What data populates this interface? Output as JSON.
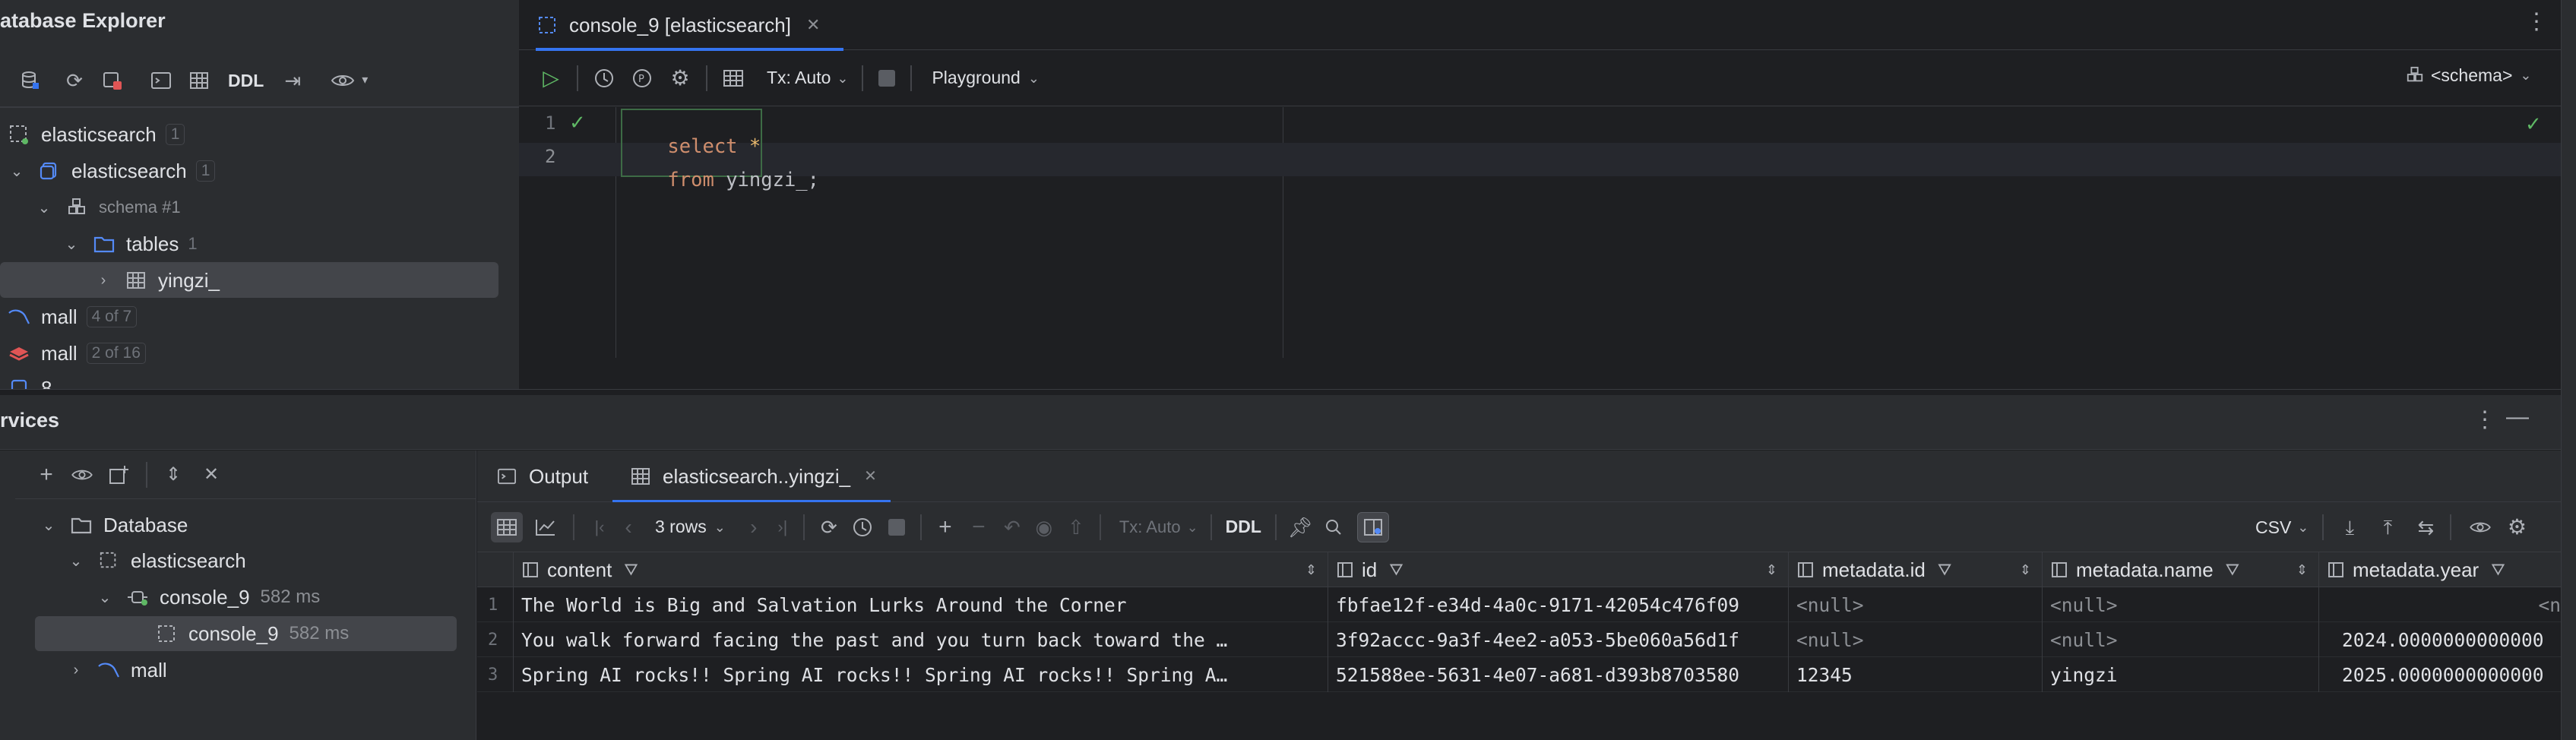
{
  "db_explorer": {
    "title": "atabase Explorer",
    "toolbar": {
      "ddl_label": "DDL"
    },
    "tree": [
      {
        "label": "elasticsearch",
        "count": "1"
      },
      {
        "label": "elasticsearch",
        "count": "1"
      },
      {
        "label": "schema #1",
        "count": ""
      },
      {
        "label": "tables",
        "count": "1"
      },
      {
        "label": "yingzi_",
        "count": ""
      },
      {
        "label": "mall",
        "count": "4 of 7"
      },
      {
        "label": "mall",
        "count": "2 of 16"
      },
      {
        "label": "8",
        "count": ""
      }
    ]
  },
  "editor": {
    "tab_label": "console_9 [elasticsearch]",
    "toolbar": {
      "tx_label": "Tx: Auto",
      "playground_label": "Playground",
      "schema_label": "<schema>"
    },
    "lines": [
      {
        "num": "1",
        "kw": "select",
        "rest": " *"
      },
      {
        "num": "2",
        "kw": "from",
        "rest": " yingzi_;"
      }
    ]
  },
  "services": {
    "title": "rvices",
    "tree": [
      {
        "label": "Database",
        "time": ""
      },
      {
        "label": "elasticsearch",
        "time": ""
      },
      {
        "label": "console_9",
        "time": "582 ms"
      },
      {
        "label": "console_9",
        "time": "582 ms"
      },
      {
        "label": "mall",
        "time": ""
      }
    ],
    "tabs": {
      "output_label": "Output",
      "result_label": "elasticsearch..yingzi_"
    },
    "grid_toolbar": {
      "rows_label": "3 rows",
      "tx_label": "Tx: Auto",
      "ddl_label": "DDL",
      "csv_label": "CSV"
    },
    "columns": [
      "content",
      "id",
      "metadata.id",
      "metadata.name",
      "metadata.year"
    ],
    "rows": [
      {
        "num": "1",
        "content": "The World is Big and Salvation Lurks Around the Corner",
        "id": "fbfae12f-e34d-4a0c-9171-42054c476f09",
        "metadata_id": "<null>",
        "metadata_name": "<null>",
        "metadata_year": "<n"
      },
      {
        "num": "2",
        "content": "You walk forward facing the past and you turn back toward the …",
        "id": "3f92accc-9a3f-4ee2-a053-5be060a56d1f",
        "metadata_id": "<null>",
        "metadata_name": "<null>",
        "metadata_year": "2024.0000000000000"
      },
      {
        "num": "3",
        "content": "Spring AI rocks!! Spring AI rocks!! Spring AI rocks!! Spring A…",
        "id": "521588ee-5631-4e07-a681-d393b8703580",
        "metadata_id": "12345",
        "metadata_name": "yingzi",
        "metadata_year": "2025.0000000000000"
      }
    ]
  },
  "colors": {
    "bg": "#1e1f22",
    "panel": "#2b2d30",
    "accent": "#3574f0",
    "keyword": "#cf8e6d",
    "run_green": "#5fb865"
  },
  "icons": [
    "refresh-icon",
    "table-icon",
    "eye-icon",
    "check-icon",
    "run-icon",
    "history-icon",
    "gear-icon",
    "filter-icon",
    "sort-icon",
    "download-icon",
    "upload-icon",
    "pin-icon",
    "search-icon",
    "plus-icon"
  ]
}
